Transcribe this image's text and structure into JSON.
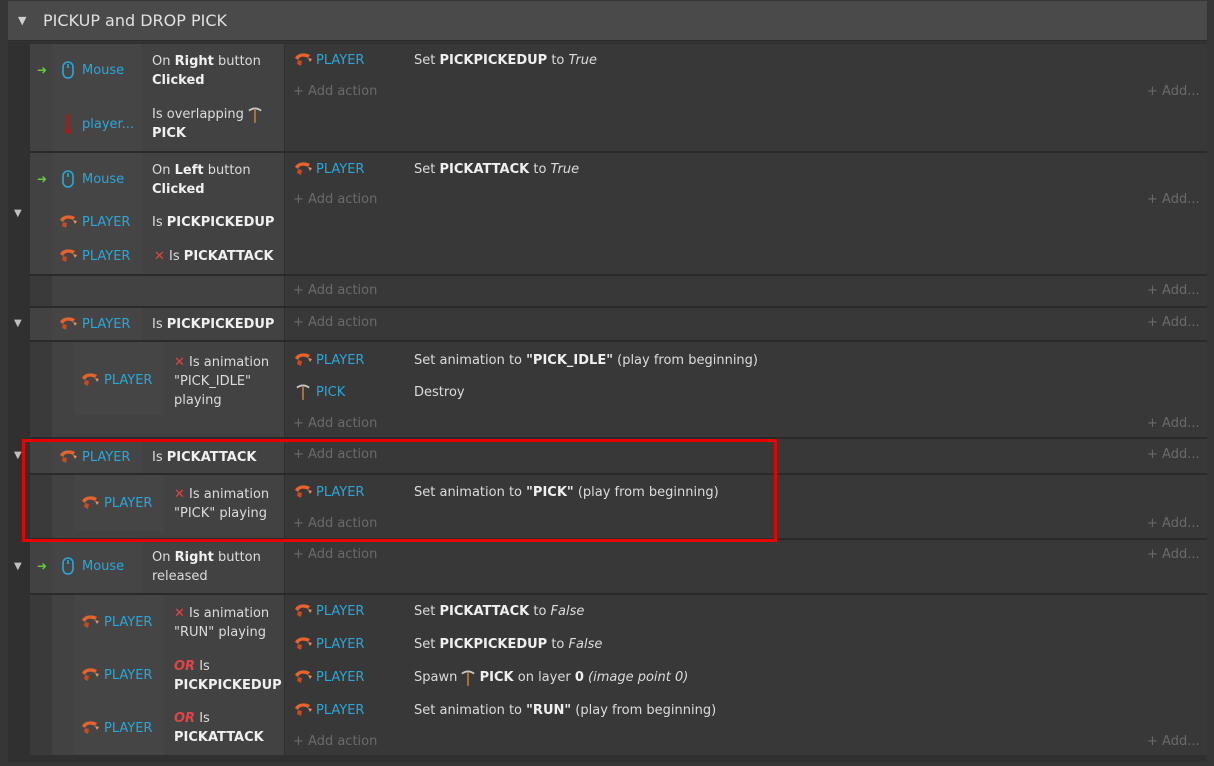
{
  "group": {
    "title": "PICKUP and DROP PICK"
  },
  "labels": {
    "add_action": "Add action",
    "add": "Add..."
  },
  "objects": {
    "mouse": "Mouse",
    "player": "PLAYER",
    "player_trunc": "player...",
    "pick": "PICK"
  },
  "e1": {
    "c1": {
      "t1": "On ",
      "b1": "Right",
      "t2": " button",
      "b2": "Clicked"
    },
    "c2": {
      "t1": "Is overlapping",
      "b1": "PICK"
    },
    "a1": {
      "t1": "Set ",
      "b1": "PICKPICKEDUP",
      "t2": " to ",
      "i1": "True"
    }
  },
  "e2": {
    "c1": {
      "t1": "On ",
      "b1": "Left",
      "t2": " button",
      "b2": "Clicked"
    },
    "c2": {
      "t1": "Is ",
      "b1": "PICKPICKEDUP"
    },
    "c3": {
      "t1": "Is ",
      "b1": "PICKATTACK"
    },
    "a1": {
      "t1": "Set ",
      "b1": "PICKATTACK",
      "t2": " to ",
      "i1": "True"
    }
  },
  "e4": {
    "c1": {
      "t1": "Is ",
      "b1": "PICKPICKEDUP"
    },
    "sub": {
      "c1": {
        "l1": "Is animation",
        "l2": "\"PICK_IDLE\"",
        "l3": "playing"
      },
      "a1": {
        "t1": "Set animation to ",
        "b1": "\"PICK_IDLE\"",
        "t2": " (play from beginning)"
      },
      "a2": {
        "t1": "Destroy"
      }
    }
  },
  "e5": {
    "c1": {
      "t1": "Is ",
      "b1": "PICKATTACK"
    },
    "sub": {
      "c1": {
        "l1": "Is animation",
        "l2": "\"PICK\" playing"
      },
      "a1": {
        "t1": "Set animation to ",
        "b1": "\"PICK\"",
        "t2": " (play from beginning)"
      }
    }
  },
  "e6": {
    "c1": {
      "t1": "On ",
      "b1": "Right",
      "t2": " button",
      "l2": "released"
    },
    "sub": {
      "c1": {
        "l1": "Is animation",
        "l2": "\"RUN\" playing"
      },
      "c2": {
        "or": "OR",
        "t1": " Is",
        "b1": "PICKPICKEDUP"
      },
      "c3": {
        "or": "OR",
        "t1": " Is",
        "b1": "PICKATTACK"
      },
      "a1": {
        "t1": "Set ",
        "b1": "PICKATTACK",
        "t2": " to ",
        "i1": "False"
      },
      "a2": {
        "t1": "Set ",
        "b1": "PICKPICKEDUP",
        "t2": " to ",
        "i1": "False"
      },
      "a3": {
        "t1": "Spawn ",
        "b1": "PICK",
        "t2": " on layer ",
        "b2": "0",
        "i1": " (image point 0)"
      },
      "a4": {
        "t1": "Set animation to ",
        "b1": "\"RUN\"",
        "t2": " (play from beginning)"
      }
    }
  },
  "colors": {
    "accent_blue": "#2aa7d8",
    "invert_red": "#e04545",
    "trigger_green": "#5fcf3e",
    "highlight_red": "#e60000"
  }
}
